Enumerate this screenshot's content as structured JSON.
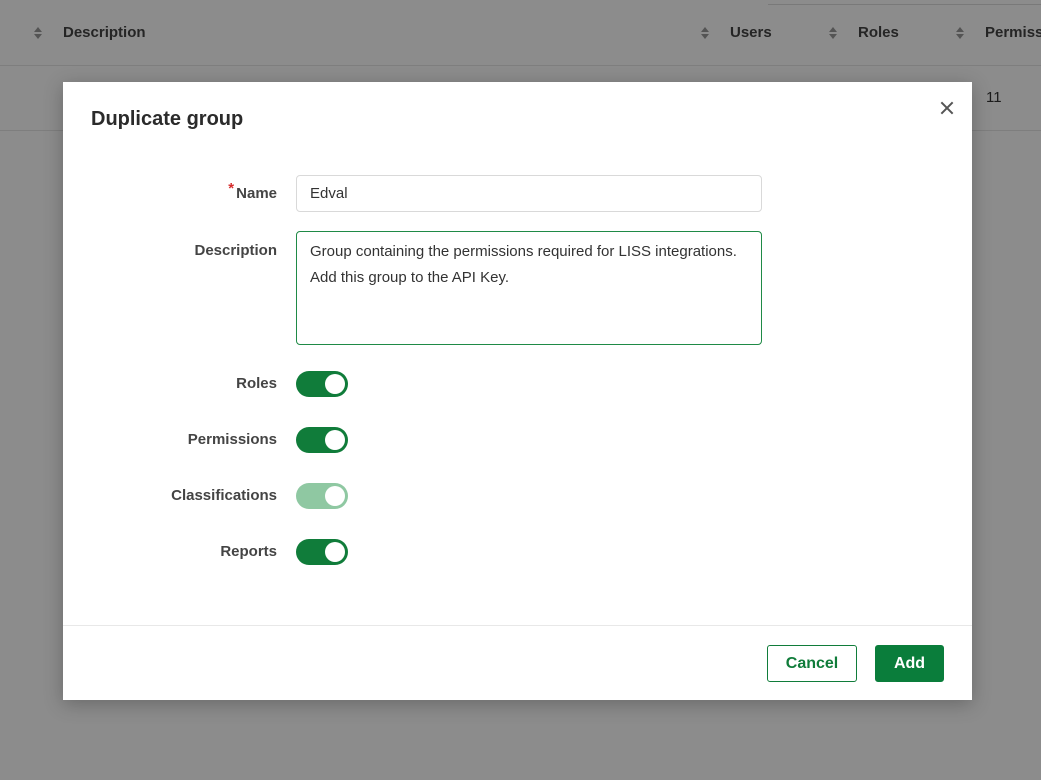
{
  "background_table": {
    "columns": [
      {
        "label": "Description"
      },
      {
        "label": "Users"
      },
      {
        "label": "Roles"
      },
      {
        "label": "Permiss"
      }
    ],
    "row_cell_value": "11"
  },
  "modal": {
    "title": "Duplicate group",
    "fields": {
      "name": {
        "label": "Name",
        "required_marker": "*",
        "value": "Edval"
      },
      "description": {
        "label": "Description",
        "value": "Group containing the permissions required for LISS integrations. Add this group to the API Key."
      }
    },
    "toggles": [
      {
        "label": "Roles",
        "on": true,
        "disabled": false
      },
      {
        "label": "Permissions",
        "on": true,
        "disabled": false
      },
      {
        "label": "Classifications",
        "on": true,
        "disabled": true
      },
      {
        "label": "Reports",
        "on": true,
        "disabled": false
      }
    ],
    "buttons": {
      "cancel": "Cancel",
      "add": "Add"
    }
  },
  "colors": {
    "accent": "#107c3a",
    "accent_disabled": "#8fc8a2",
    "required": "#d62d2d"
  }
}
